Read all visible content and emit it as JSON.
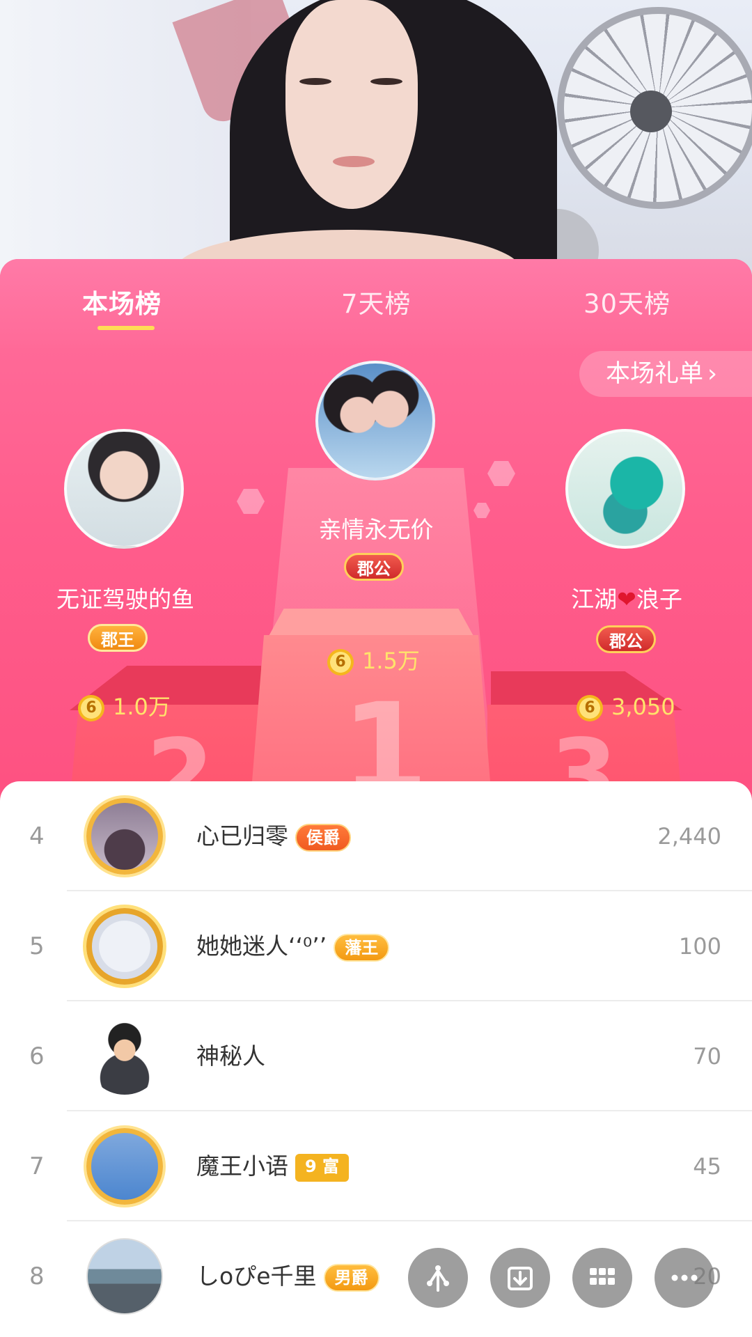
{
  "tabs": [
    {
      "label": "本场榜",
      "active": true
    },
    {
      "label": "7天榜",
      "active": false
    },
    {
      "label": "30天榜",
      "active": false
    }
  ],
  "gift_list_button": {
    "label": "本场礼单",
    "chevron": "›"
  },
  "podium": {
    "first": {
      "rank": "1",
      "name": "亲情永无价",
      "badge": "郡公",
      "score": "1.5万"
    },
    "second": {
      "rank": "2",
      "name": "无证驾驶的鱼",
      "badge": "郡王",
      "score": "1.0万"
    },
    "third": {
      "rank": "3",
      "name_part1": "江湖",
      "name_heart": "❤",
      "name_part2": "浪子",
      "badge": "郡公",
      "score": "3,050"
    }
  },
  "coin_icon_label": "6",
  "rows": [
    {
      "rank": "4",
      "name": "心已归零",
      "badge": "侯爵",
      "value": "2,440"
    },
    {
      "rank": "5",
      "name": "她她迷人ʻʻ⁰ʼʼ",
      "badge": "藩王",
      "value": "100"
    },
    {
      "rank": "6",
      "name": "神秘人",
      "badge": "",
      "value": "70"
    },
    {
      "rank": "7",
      "name": "魔王小语",
      "badge": "9 富",
      "value": "45"
    },
    {
      "rank": "8",
      "name": "しoぴe千里",
      "badge": "男爵",
      "value": "20"
    }
  ],
  "fabs": [
    "share-icon",
    "download-icon",
    "grid-icon",
    "more-icon"
  ],
  "colors": {
    "accent": "#ff5d8c",
    "gold": "#ffe36b"
  }
}
